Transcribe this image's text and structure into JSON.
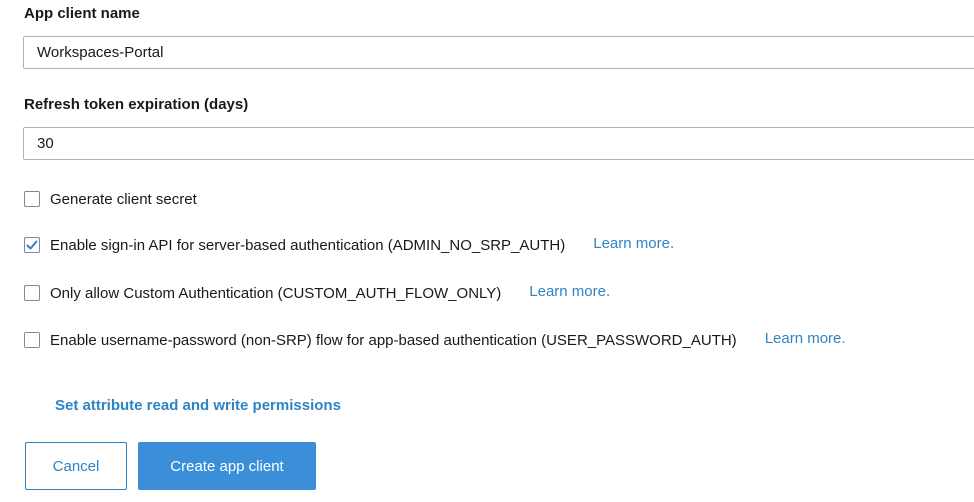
{
  "form": {
    "app_client_name": {
      "label": "App client name",
      "value": "Workspaces-Portal"
    },
    "refresh_token": {
      "label": "Refresh token expiration (days)",
      "value": "30"
    },
    "options": [
      {
        "label": "Generate client secret",
        "checked": false,
        "link": ""
      },
      {
        "label": "Enable sign-in API for server-based authentication (ADMIN_NO_SRP_AUTH)",
        "checked": true,
        "link": "Learn more."
      },
      {
        "label": "Only allow Custom Authentication (CUSTOM_AUTH_FLOW_ONLY)",
        "checked": false,
        "link": "Learn more."
      },
      {
        "label": "Enable username-password (non-SRP) flow for app-based authentication (USER_PASSWORD_AUTH)",
        "checked": false,
        "link": "Learn more."
      }
    ],
    "attribute_permissions_link": "Set attribute read and write permissions"
  },
  "actions": {
    "cancel_label": "Cancel",
    "create_label": "Create app client"
  },
  "colors": {
    "accent": "#2e84c4",
    "primary_button": "#3b8fd9",
    "checkmark": "#2e84c4"
  },
  "icons": {
    "checked": "checkmark-icon"
  }
}
